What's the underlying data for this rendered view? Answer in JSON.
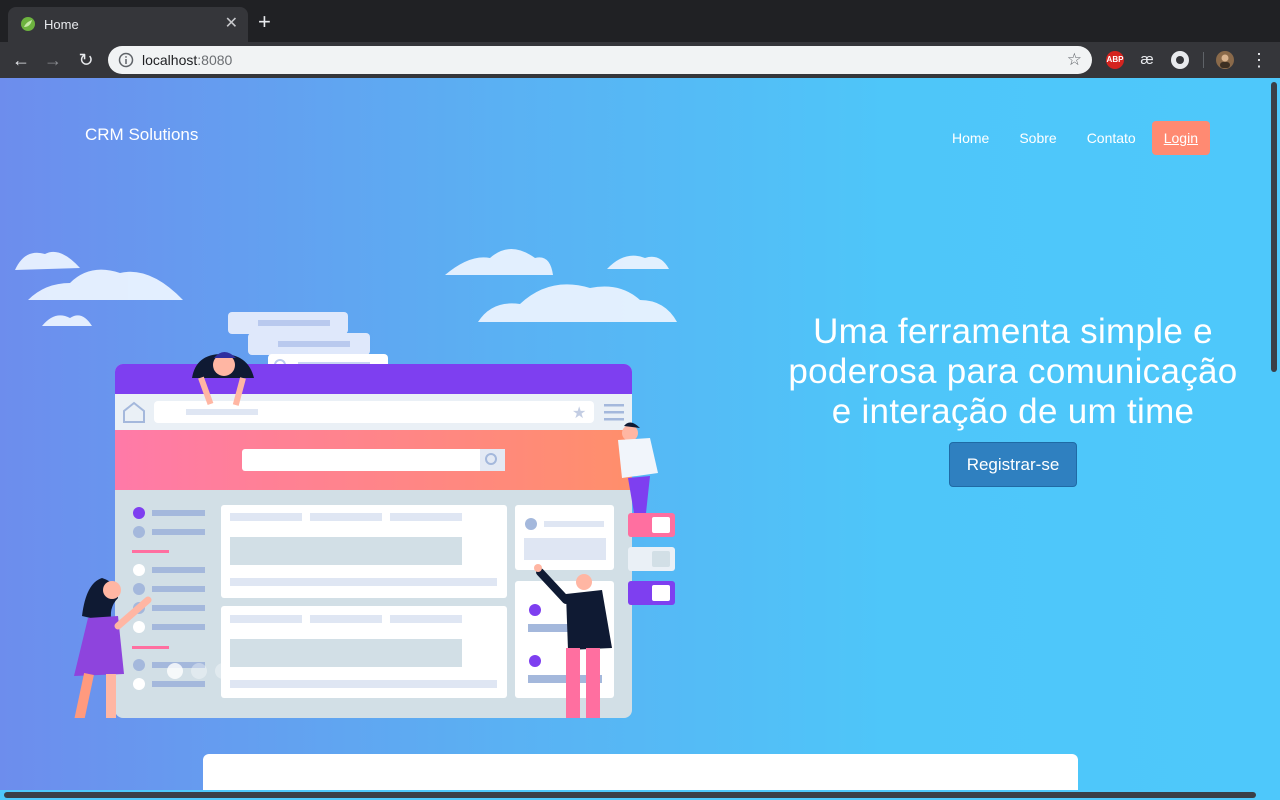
{
  "browser": {
    "tab_title": "Home",
    "new_tab_symbol": "+",
    "close_symbol": "✕",
    "url_host": "localhost",
    "url_port": ":8080",
    "ext_abp": "ABP",
    "ext_ae": "æ"
  },
  "site": {
    "brand": "CRM Solutions",
    "nav": {
      "home": "Home",
      "about": "Sobre",
      "contact": "Contato",
      "login": "Login"
    },
    "hero": {
      "title_line1": "Uma ferramenta simple e",
      "title_line2": "poderosa para comunicação",
      "title_line3": "e interação de um time",
      "cta": "Registrar-se"
    },
    "carousel": {
      "slides": 3,
      "active": 1
    }
  },
  "colors": {
    "accent_login": "#ff8a72",
    "cta": "#2f80c0",
    "gradient_start": "#6d8ded",
    "gradient_end": "#4ec8fb"
  }
}
